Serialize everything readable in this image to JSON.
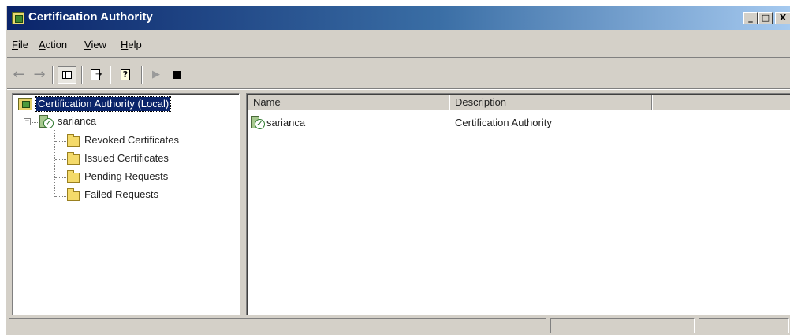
{
  "window": {
    "title": "Certification Authority",
    "controls": {
      "minimize": "_",
      "maximize": "□",
      "close": "X"
    }
  },
  "menu": [
    {
      "label": "File",
      "hotkey": "F"
    },
    {
      "label": "Action",
      "hotkey": "A"
    },
    {
      "label": "View",
      "hotkey": "V"
    },
    {
      "label": "Help",
      "hotkey": "H"
    }
  ],
  "toolbar": {
    "buttons": [
      "back-icon",
      "forward-icon",
      "show-hide-tree-icon",
      "export-list-icon",
      "help-icon",
      "start-service-icon",
      "stop-service-icon"
    ]
  },
  "tree": {
    "root": "Certification Authority (Local)",
    "server": "sarianca",
    "folders": [
      "Revoked Certificates",
      "Issued Certificates",
      "Pending Requests",
      "Failed Requests"
    ]
  },
  "list": {
    "columns": [
      "Name",
      "Description",
      ""
    ],
    "rows": [
      {
        "name": "sarianca",
        "description": "Certification Authority"
      }
    ]
  },
  "status": {
    "cells": [
      "",
      "",
      ""
    ]
  },
  "colors": {
    "titlebar_start": "#0a246a",
    "titlebar_end": "#a6caf0",
    "face": "#d4d0c8",
    "selection": "#0a246a"
  }
}
